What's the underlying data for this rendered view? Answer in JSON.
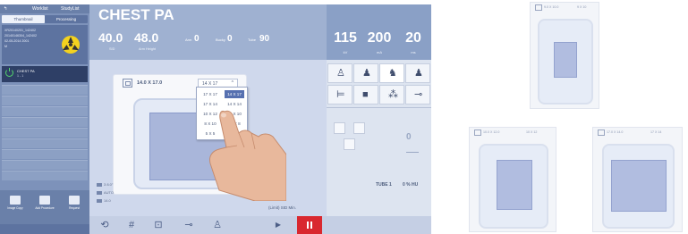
{
  "left_panel": {
    "top_tabs": [
      "Worklist",
      "StudyList"
    ],
    "sub_tabs": [
      "Thumbnail",
      "Processing"
    ],
    "patient_lines": [
      "XR20140201_142402",
      "20140146304_142402",
      "02-05-2014 2001",
      "M"
    ],
    "protocol": {
      "name": "CHEST PA",
      "count": "1 - 1"
    },
    "bottom_buttons": [
      "Image Copy",
      "Add Procedure",
      "Request"
    ]
  },
  "header": {
    "exam_title": "CHEST PA",
    "sid_value": "40.0",
    "sid_label": "SID",
    "arm_value": "48.0",
    "arm_label": "Arm Height",
    "arm_angle_label": "Arm",
    "arm_angle_value": "0",
    "bucky_label": "Bucky",
    "bucky_value": "0",
    "tube_label": "Tube",
    "tube_value": "90"
  },
  "exposure": {
    "kv_value": "115",
    "kv_label": "kV",
    "ma_value": "200",
    "ma_label": "mA",
    "ms_value": "20",
    "ms_label": "ms"
  },
  "collimator": {
    "field_size": "14.0 X 17.0",
    "selected_size": "14 X 17",
    "caret": "^",
    "options_left": [
      "17 X 17",
      "17 X 14",
      "10 X 12",
      "8 X 10",
      "5 X 5"
    ],
    "options_right": [
      "14 X 17",
      "14 X 14",
      "12 X 10",
      "10 X 8",
      "5 X 5"
    ],
    "status_lines": [
      "3 8.0\"",
      "AUTO",
      "14.0"
    ],
    "limit_text": "(Limit) SID Min."
  },
  "detector": {
    "dose_value": "0",
    "tube_text": "TUBE 1",
    "hu_text": "0 % HU"
  },
  "thumbnails": [
    {
      "label_left": "9.0 X 10.0",
      "label_right": "9 X 10"
    },
    {
      "label_left": "10.0 X 12.0",
      "label_right": "10 X 12"
    },
    {
      "label_left": "17.0 X 14.0",
      "label_right": "17 X 14"
    }
  ],
  "colors": {
    "header_blue": "#9fb1d1",
    "panel_blue": "#7d92ba",
    "accent_selected": "#5670b0",
    "stop_red": "#d9282f",
    "radiation_yellow": "#f3d21f",
    "power_green": "#53d56b"
  },
  "icons": [
    "radiation-icon",
    "power-icon",
    "collimator-icon",
    "grid-icon",
    "patient-standing-icon",
    "detector-icon",
    "tube-icon",
    "play-icon",
    "stop-icon"
  ]
}
